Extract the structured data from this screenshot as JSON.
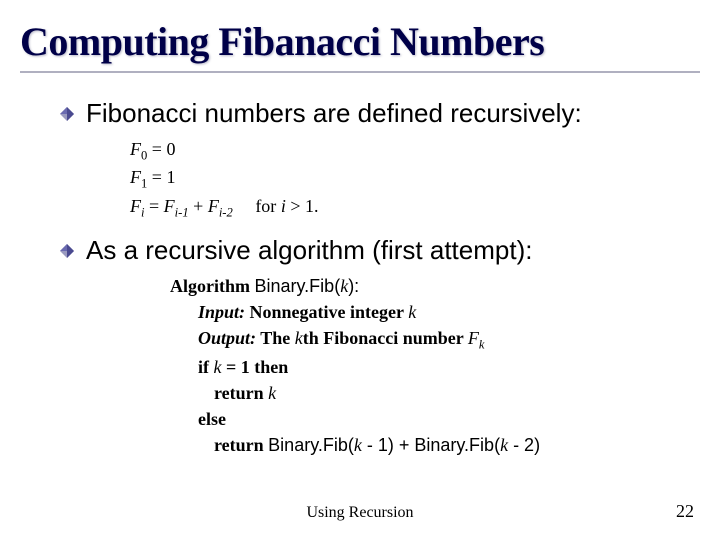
{
  "title": "Computing Fibanacci Numbers",
  "bullet1": "Fibonacci numbers are defined recursively:",
  "def_f0_lhs": "F",
  "def_f0_sub": "0",
  "def_f0_eq": " =  0",
  "def_f1_lhs": "F",
  "def_f1_sub": "1",
  "def_f1_eq": " =  1",
  "def_fi_lhs": "F",
  "def_fi_sub": "i",
  "def_fi_eq": " =  ",
  "def_fi_r1": "F",
  "def_fi_r1sub": "i-1",
  "def_fi_plus": " + ",
  "def_fi_r2": "F",
  "def_fi_r2sub": "i-2",
  "def_fi_for": "     for ",
  "def_fi_i": "i",
  "def_fi_cond": " > 1.",
  "bullet2": "As a recursive algorithm (first attempt):",
  "algo": {
    "kw_algorithm": "Algorithm ",
    "fn1": "Binary.Fib(",
    "fn1_arg": "k",
    "fn1_close": "):",
    "kw_input": "Input:",
    "input_text": " Nonnegative integer ",
    "input_k": "k",
    "kw_output": "Output:",
    "output_text1": " The ",
    "output_k": "k",
    "output_text2": "th Fibonacci number ",
    "output_F": "F",
    "output_Fk": "k",
    "kw_if": "if ",
    "if_k": "k",
    "if_eq": " = 1 ",
    "kw_then": "then",
    "kw_return1": "return ",
    "ret1_k": "k",
    "kw_else": "else",
    "kw_return2": "return ",
    "ret2_fn1": "Binary.Fib(",
    "ret2_k1": "k",
    "ret2_m1": " - 1) + ",
    "ret2_fn2": "Binary.Fib(",
    "ret2_k2": "k",
    "ret2_m2": " - 2)"
  },
  "footer_center": "Using Recursion",
  "footer_right": "22"
}
